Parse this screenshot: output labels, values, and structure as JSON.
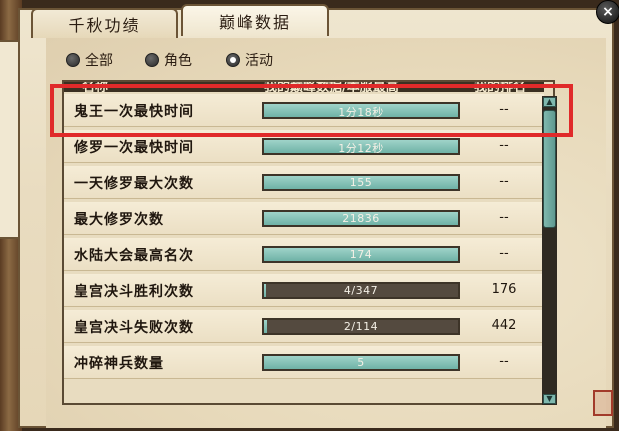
{
  "tabs": [
    {
      "label": "千秋功绩",
      "active": false
    },
    {
      "label": "巅峰数据",
      "active": true
    }
  ],
  "close_label": "×",
  "filters": [
    {
      "label": "全部",
      "selected": false
    },
    {
      "label": "角色",
      "selected": false
    },
    {
      "label": "活动",
      "selected": true
    }
  ],
  "table": {
    "headers": {
      "name": "名称",
      "value": "我的巅峰数据/本服最高",
      "rank": "我的排名"
    },
    "rows": [
      {
        "name": "鬼王一次最快时间",
        "value": "1分18秒",
        "fill": 1.0,
        "rank": "--"
      },
      {
        "name": "修罗一次最快时间",
        "value": "1分12秒",
        "fill": 1.0,
        "rank": "--"
      },
      {
        "name": "一天修罗最大次数",
        "value": "155",
        "fill": 1.0,
        "rank": "--"
      },
      {
        "name": "最大修罗次数",
        "value": "21836",
        "fill": 1.0,
        "rank": "--"
      },
      {
        "name": "水陆大会最高名次",
        "value": "174",
        "fill": 1.0,
        "rank": "--"
      },
      {
        "name": "皇宫决斗胜利次数",
        "value": "4/347",
        "fill": 0.0115,
        "rank": "176"
      },
      {
        "name": "皇宫决斗失败次数",
        "value": "2/114",
        "fill": 0.0175,
        "rank": "442"
      },
      {
        "name": "冲碎神兵数量",
        "value": "5",
        "fill": 1.0,
        "rank": "--"
      }
    ]
  },
  "colors": {
    "highlight": "#e02a2a",
    "bar_fill": "#7fbfb3",
    "bar_empty": "#544a3f"
  }
}
